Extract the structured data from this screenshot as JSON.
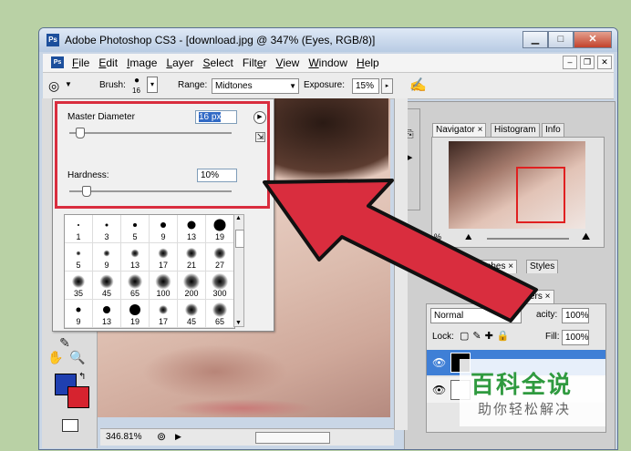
{
  "window": {
    "title": "Adobe Photoshop CS3 - [download.jpg @ 347% (Eyes, RGB/8)]",
    "logo_text": "Ps"
  },
  "menu": {
    "items": [
      {
        "u": "F",
        "rest": "ile"
      },
      {
        "u": "E",
        "rest": "dit"
      },
      {
        "u": "I",
        "rest": "mage"
      },
      {
        "u": "L",
        "rest": "ayer"
      },
      {
        "u": "S",
        "rest": "elect"
      },
      {
        "pre": "Filt",
        "u": "e",
        "rest": "r"
      },
      {
        "u": "V",
        "rest": "iew"
      },
      {
        "u": "W",
        "rest": "indow"
      },
      {
        "u": "H",
        "rest": "elp"
      }
    ]
  },
  "options": {
    "brush_label": "Brush:",
    "brush_size": "16",
    "range_label": "Range:",
    "range_value": "Midtones",
    "exposure_label": "Exposure:",
    "exposure_value": "15%"
  },
  "brush_popup": {
    "master_diameter_label": "Master Diameter",
    "master_diameter_value": "16 px",
    "master_diameter_level": 0.06,
    "hardness_label": "Hardness:",
    "hardness_value": "10%",
    "hardness_level": 0.1,
    "presets": [
      {
        "size": "1",
        "soft": false,
        "d": 2
      },
      {
        "size": "3",
        "soft": false,
        "d": 3
      },
      {
        "size": "5",
        "soft": false,
        "d": 4
      },
      {
        "size": "9",
        "soft": false,
        "d": 6
      },
      {
        "size": "13",
        "soft": false,
        "d": 9
      },
      {
        "size": "19",
        "soft": false,
        "d": 13
      },
      {
        "size": "5",
        "soft": true,
        "d": 5
      },
      {
        "size": "9",
        "soft": true,
        "d": 7
      },
      {
        "size": "13",
        "soft": true,
        "d": 9
      },
      {
        "size": "17",
        "soft": true,
        "d": 11
      },
      {
        "size": "21",
        "soft": true,
        "d": 12
      },
      {
        "size": "27",
        "soft": true,
        "d": 13
      },
      {
        "size": "35",
        "soft": true,
        "d": 14
      },
      {
        "size": "45",
        "soft": true,
        "d": 15
      },
      {
        "size": "65",
        "soft": true,
        "d": 16
      },
      {
        "size": "100",
        "soft": true,
        "d": 17
      },
      {
        "size": "200",
        "soft": true,
        "d": 18
      },
      {
        "size": "300",
        "soft": true,
        "d": 18
      },
      {
        "size": "9",
        "soft": false,
        "d": 5
      },
      {
        "size": "13",
        "soft": false,
        "d": 8
      },
      {
        "size": "19",
        "soft": false,
        "d": 12
      },
      {
        "size": "17",
        "soft": true,
        "d": 10
      },
      {
        "size": "45",
        "soft": true,
        "d": 14
      },
      {
        "size": "65",
        "soft": true,
        "d": 16
      }
    ]
  },
  "status": {
    "zoom": "346.81%"
  },
  "navigator_panel": {
    "tabs": [
      "Navigator",
      "Histogram",
      "Info"
    ],
    "zoom_text": "%"
  },
  "swatches_panel": {
    "tabs": [
      "atches",
      "Styles"
    ]
  },
  "layers_panel": {
    "tab": "ers",
    "blend_mode": "Normal",
    "opacity_label": "acity:",
    "opacity_value": "100%",
    "lock_label": "Lock:",
    "fill_label": "Fill:",
    "fill_value": "100%"
  },
  "watermark": {
    "main": "百科全说",
    "sub": "助你轻松解决"
  },
  "colors": {
    "annotation_red": "#d92d3e",
    "foreground_color": "#1f3fb0",
    "background_color": "#d6232f"
  }
}
